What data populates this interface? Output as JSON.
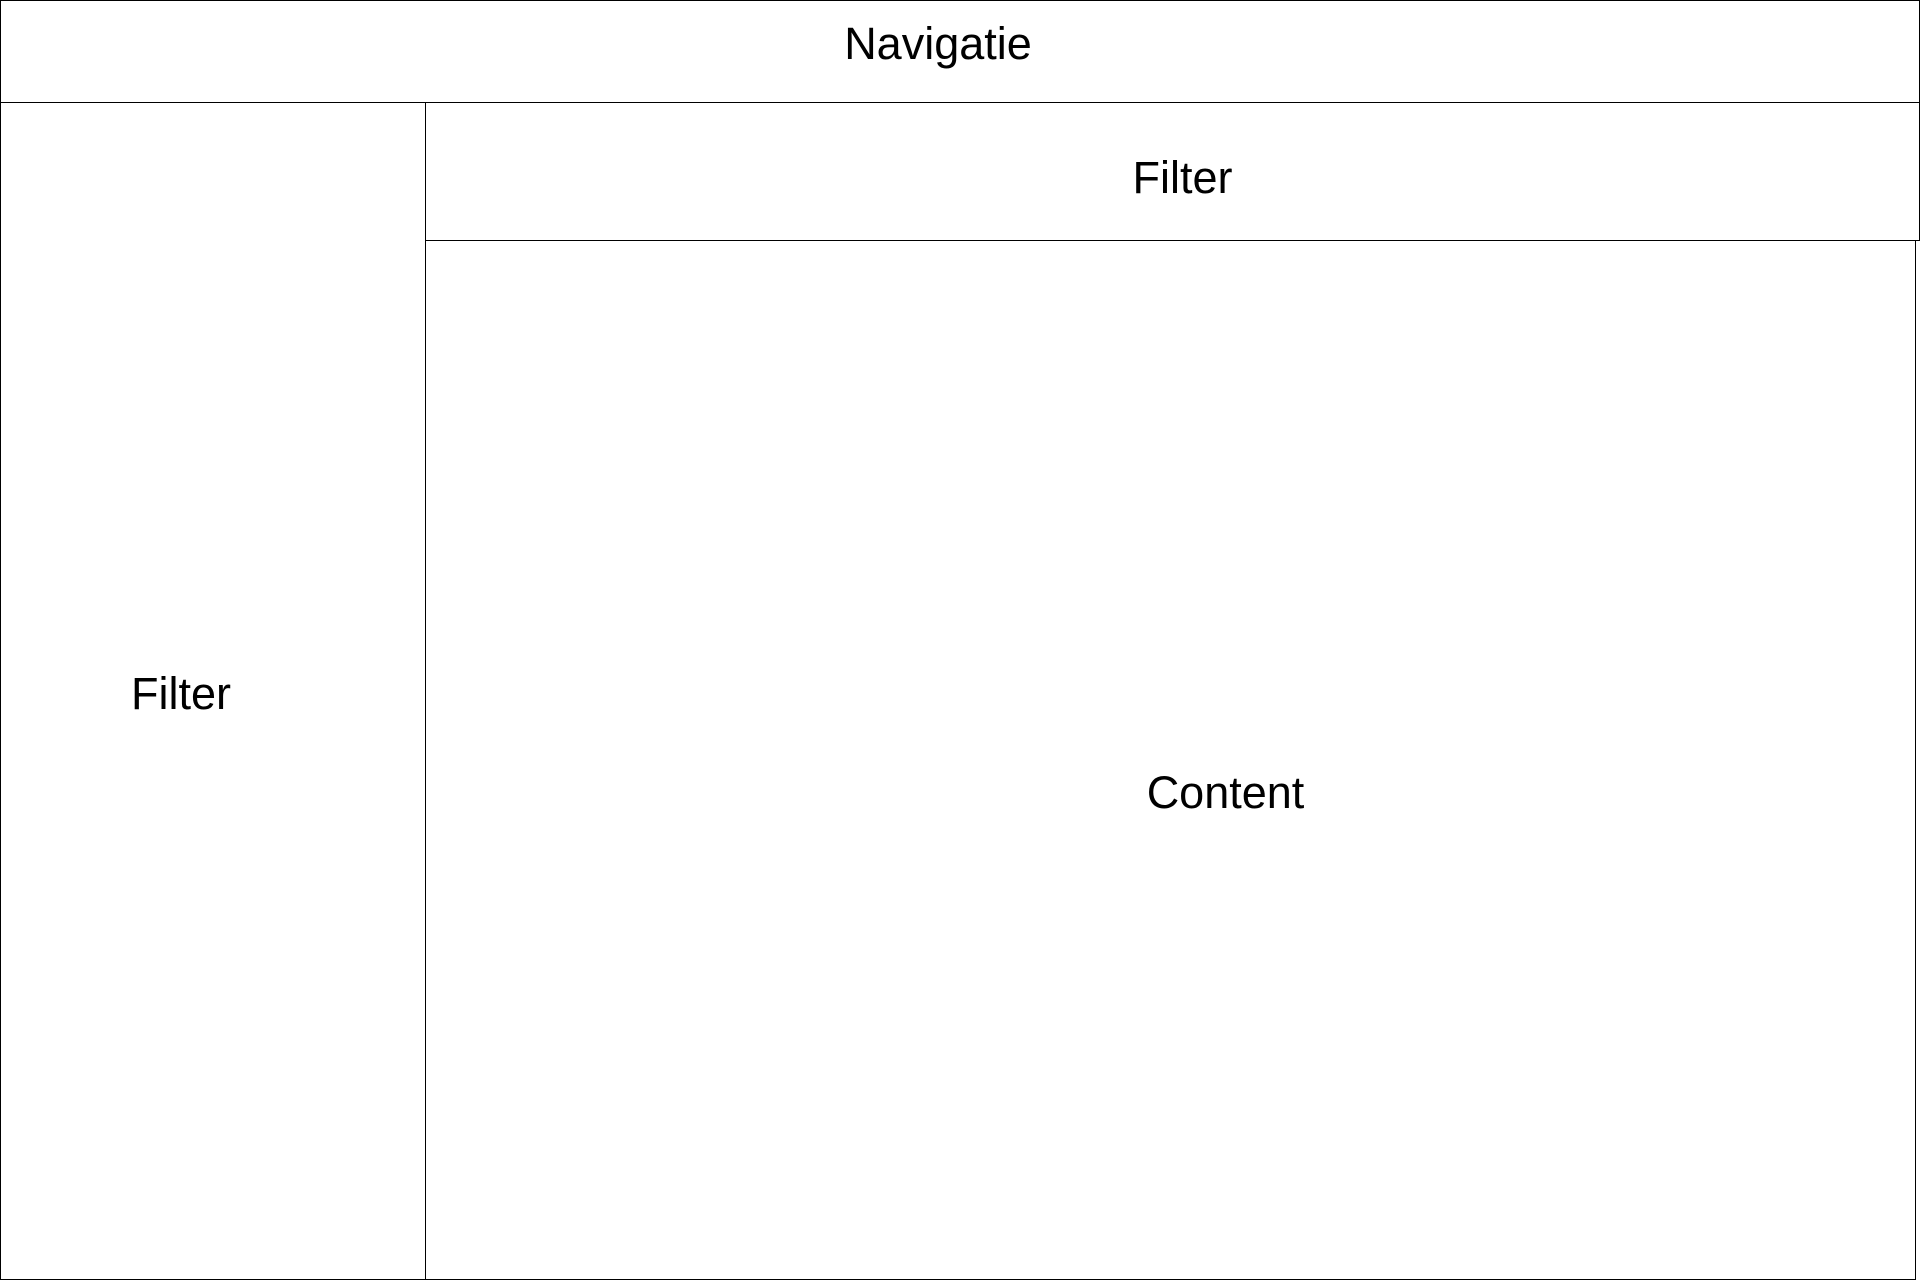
{
  "wireframe": {
    "navigation": {
      "label": "Navigatie"
    },
    "left_filter": {
      "label": "Filter"
    },
    "top_filter": {
      "label": "Filter"
    },
    "content": {
      "label": "Content"
    }
  },
  "colors": {
    "border": "#000000",
    "background": "#ffffff",
    "text": "#000000"
  }
}
